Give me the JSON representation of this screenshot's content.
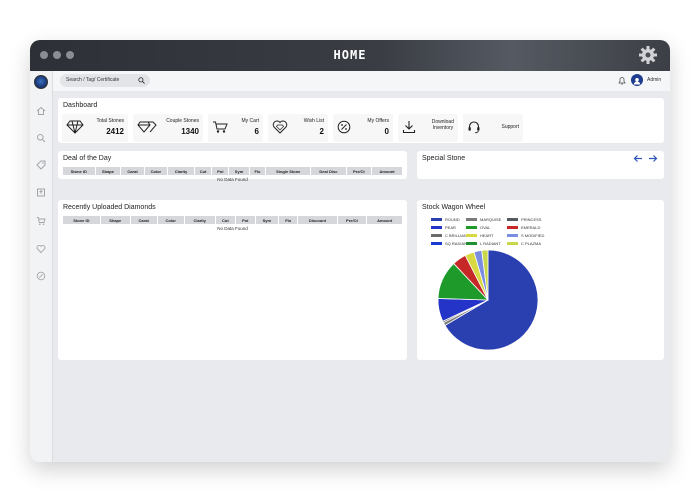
{
  "window": {
    "title": "HOME"
  },
  "search": {
    "placeholder": "Search / Tag/ Certificate"
  },
  "user": {
    "name": "Admin"
  },
  "dashboard": {
    "title": "Dashboard",
    "stats": [
      {
        "label": "Total Stones",
        "value": "2412",
        "icon": "diamond-icon"
      },
      {
        "label": "Couple Stones",
        "value": "1340",
        "icon": "couple-diamond-icon"
      },
      {
        "label": "My Cart",
        "value": "6",
        "icon": "cart-icon"
      },
      {
        "label": "Wish List",
        "value": "2",
        "icon": "heart-diamond-icon"
      },
      {
        "label": "My Offers",
        "value": "0",
        "icon": "offer-icon"
      }
    ],
    "download": {
      "line1": "Download",
      "line2": "Inventory"
    },
    "support": {
      "label": "Support"
    }
  },
  "deal": {
    "title": "Deal of the Day",
    "columns": [
      "Stone ID",
      "Shape",
      "Carat",
      "Color",
      "Clarity",
      "Cut",
      "Pol",
      "Sym",
      "Flo",
      "Single Stone",
      "Deal Disc",
      "Per/Ct",
      "Amount"
    ],
    "empty": "No Data Found"
  },
  "special": {
    "title": "Special Stone"
  },
  "recent": {
    "title": "Recently Uploaded Diamonds",
    "columns": [
      "Stone ID",
      "Shape",
      "Carat",
      "Color",
      "Clarity",
      "Cut",
      "Pol",
      "Sym",
      "Flo",
      "Discount",
      "Per/Ct",
      "Amount"
    ],
    "empty": "No Data Found"
  },
  "chart_data": {
    "type": "pie",
    "title": "Stock Wagon Wheel",
    "legend": [
      {
        "name": "ROUND",
        "color": "#2a3fb0"
      },
      {
        "name": "MARQUISE",
        "color": "#7a7a7a"
      },
      {
        "name": "PRINCESS",
        "color": "#555a60"
      },
      {
        "name": "PEAR",
        "color": "#2434c8"
      },
      {
        "name": "OVAL",
        "color": "#1e9a2a"
      },
      {
        "name": "EMERALD",
        "color": "#c62828"
      },
      {
        "name": "C BRILLIANT",
        "color": "#6b6b6b"
      },
      {
        "name": "HEART",
        "color": "#d8d840"
      },
      {
        "name": "S MODIFIED",
        "color": "#7b8de0"
      },
      {
        "name": "SQ RADIANT",
        "color": "#1a3ad0"
      },
      {
        "name": "L RADIANT",
        "color": "#1f8f2f"
      },
      {
        "name": "C PLAZMA",
        "color": "#c8d84a"
      }
    ],
    "slices": [
      {
        "name": "ROUND",
        "value": 66.5,
        "color": "#2a3fb0"
      },
      {
        "name": "MARQUISE",
        "value": 1.0,
        "color": "#7a7a7a"
      },
      {
        "name": "PRINCESS",
        "value": 0.5,
        "color": "#555a60"
      },
      {
        "name": "PEAR",
        "value": 7.5,
        "color": "#2434c8"
      },
      {
        "name": "OVAL",
        "value": 12.5,
        "color": "#1e9a2a"
      },
      {
        "name": "EMERALD",
        "value": 4.5,
        "color": "#c62828"
      },
      {
        "name": "HEART",
        "value": 3.0,
        "color": "#d8d840"
      },
      {
        "name": "S MODIFIED",
        "value": 2.5,
        "color": "#7b8de0"
      },
      {
        "name": "C PLAZMA",
        "value": 2.0,
        "color": "#c8d84a"
      }
    ]
  }
}
